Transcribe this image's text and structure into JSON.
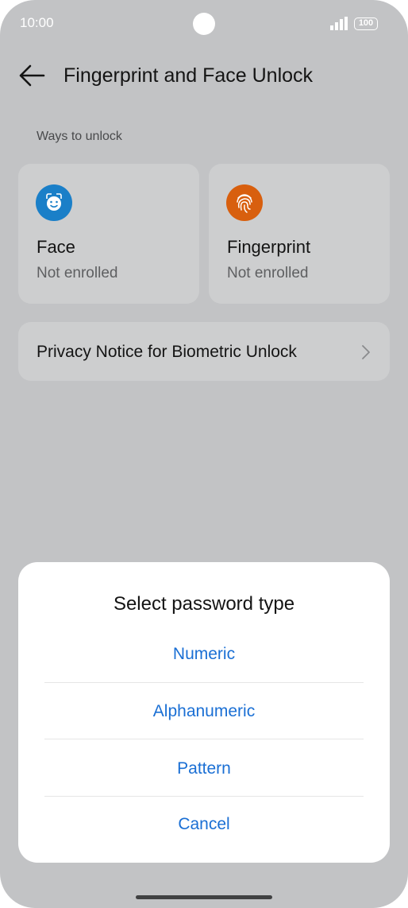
{
  "status_bar": {
    "time": "10:00",
    "battery": "100"
  },
  "header": {
    "title": "Fingerprint and Face Unlock"
  },
  "section": {
    "label": "Ways to unlock"
  },
  "methods": [
    {
      "title": "Face",
      "status": "Not enrolled",
      "icon": "face-icon",
      "color": "#1a7fc8"
    },
    {
      "title": "Fingerprint",
      "status": "Not enrolled",
      "icon": "fingerprint-icon",
      "color": "#d85f0e"
    }
  ],
  "privacy": {
    "label": "Privacy Notice for Biometric Unlock"
  },
  "dialog": {
    "title": "Select password type",
    "options": [
      "Numeric",
      "Alphanumeric",
      "Pattern"
    ],
    "cancel": "Cancel"
  },
  "colors": {
    "accent": "#1a6fd4",
    "scrim": "#c2c3c5"
  }
}
